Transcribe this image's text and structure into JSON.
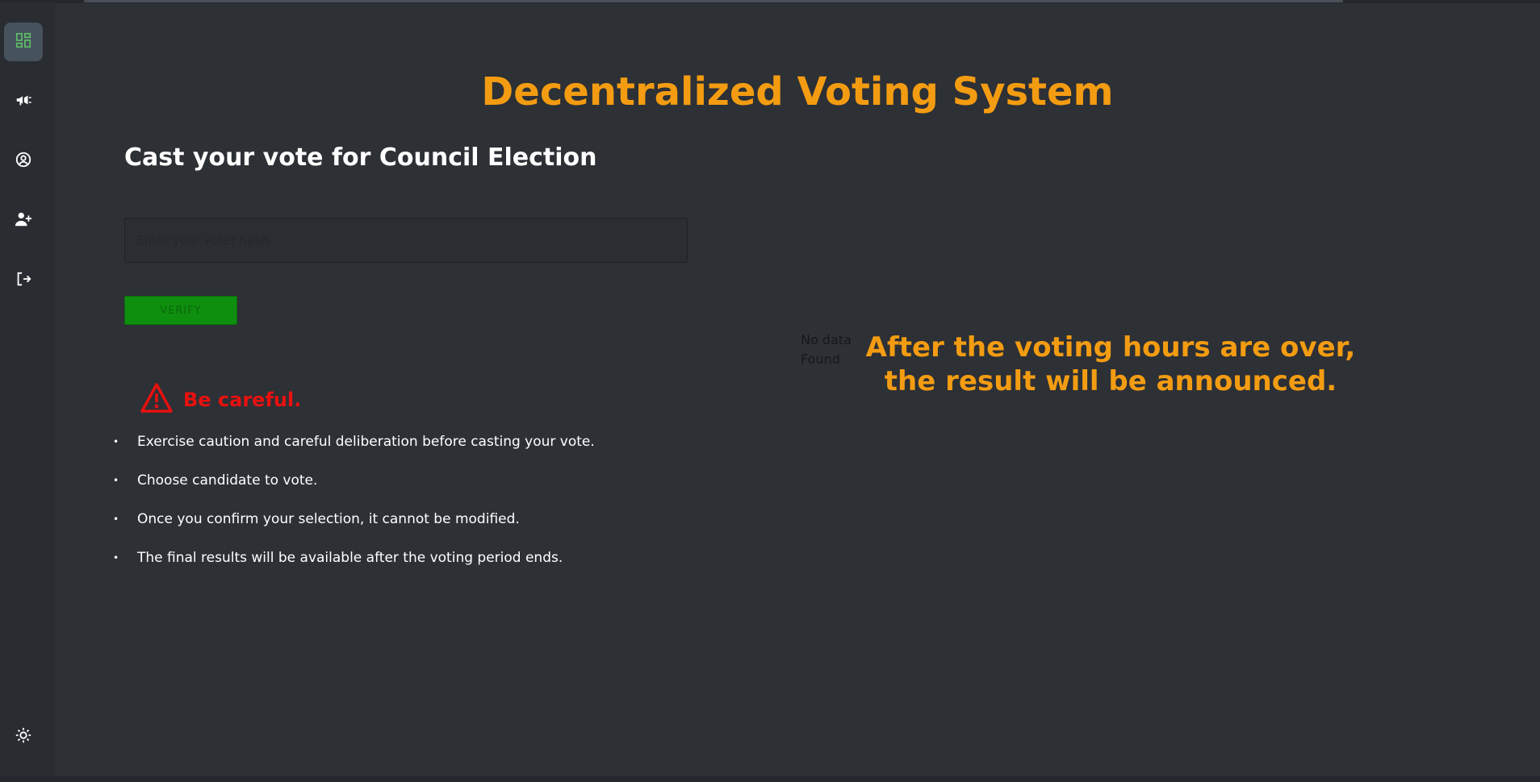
{
  "app": {
    "title": "Decentralized Voting System"
  },
  "sidebar": {
    "items": [
      {
        "icon": "dashboard-icon",
        "active": true
      },
      {
        "icon": "megaphone-icon",
        "active": false
      },
      {
        "icon": "user-circle-icon",
        "active": false
      },
      {
        "icon": "add-user-icon",
        "active": false
      },
      {
        "icon": "logout-icon",
        "active": false
      }
    ],
    "theme_toggle_icon": "sun-icon"
  },
  "vote": {
    "heading": "Cast your vote for Council Election",
    "hash_placeholder": "Enter your voter hash",
    "verify_label": "VERIFY"
  },
  "warning": {
    "icon": "warning-triangle-icon",
    "title": "Be careful.",
    "items": [
      "Exercise caution and careful deliberation before casting your vote.",
      "Choose candidate to vote.",
      "Once you confirm your selection, it cannot be modified.",
      "The final results will be available after the voting period ends."
    ]
  },
  "results": {
    "no_data": "No data Found",
    "message": "After the voting hours are over, the result will be announced."
  },
  "colors": {
    "background": "#2d3035",
    "sidebar": "#292c31",
    "accent": "#f39c12",
    "danger": "#e8110f",
    "verify": "#0e8f0e",
    "active_icon": "#5fbf6a"
  }
}
